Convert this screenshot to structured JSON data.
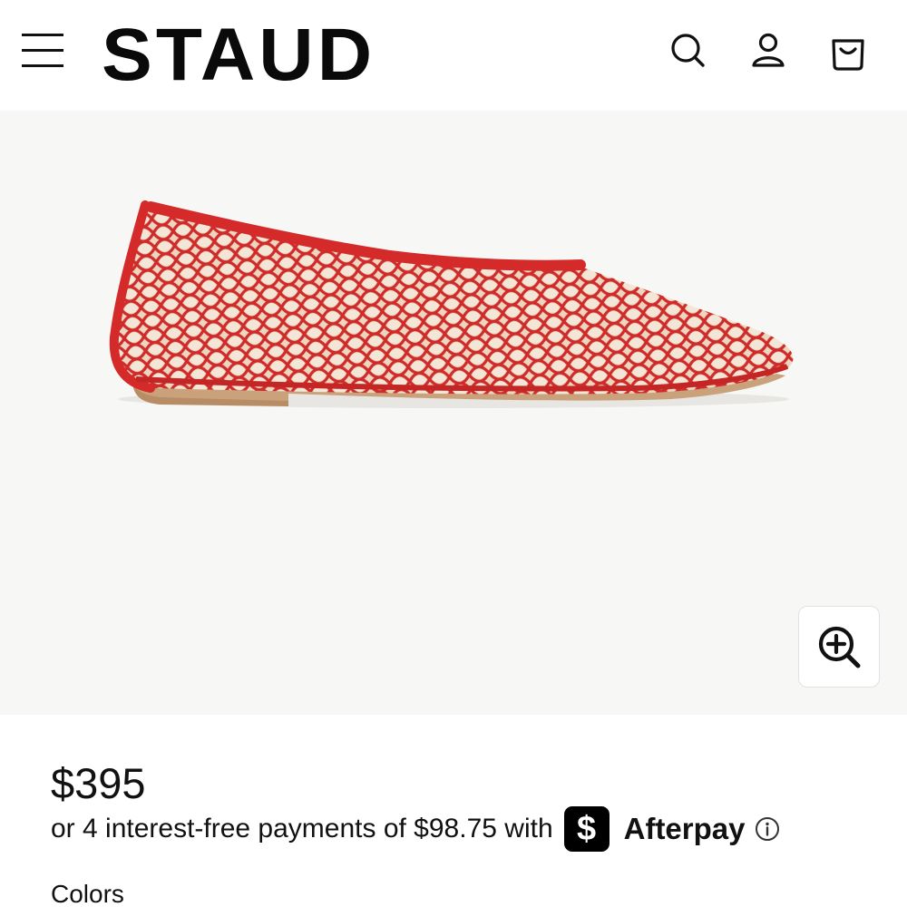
{
  "header": {
    "logo_text": "STAUD",
    "icons": [
      "menu-icon",
      "search-icon",
      "account-icon",
      "cart-icon"
    ]
  },
  "product": {
    "image_alt": "red-mesh-ballet-flat",
    "zoom_icon": "zoom-in-icon"
  },
  "pricing": {
    "price": "$395",
    "installment_text": "or 4 interest-free payments of $98.75 with",
    "cash_app_symbol": "$",
    "provider": "Afterpay",
    "info_icon": "info-icon"
  },
  "options": {
    "colors_label": "Colors"
  },
  "colors": {
    "shoe_red": "#d42a2a",
    "background": "#f7f7f5",
    "text": "#111111"
  }
}
